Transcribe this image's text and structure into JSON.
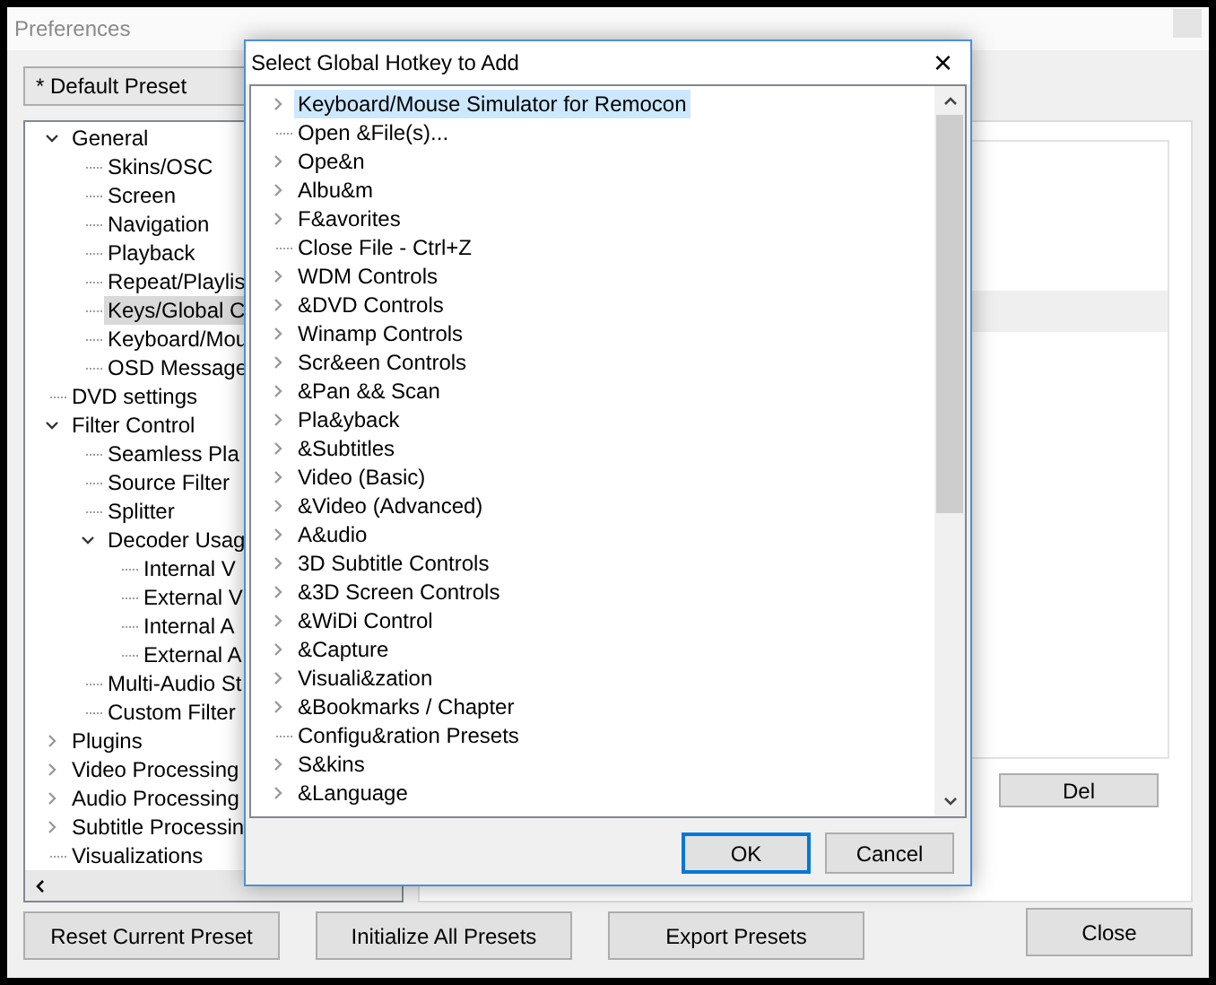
{
  "window": {
    "title": "Preferences"
  },
  "preset": {
    "value": "* Default Preset"
  },
  "tree": [
    {
      "label": "General",
      "kind": "branch",
      "expanded": true,
      "selected": false,
      "children": [
        {
          "label": "Skins/OSC",
          "kind": "leaf",
          "selected": false
        },
        {
          "label": "Screen",
          "kind": "leaf",
          "selected": false
        },
        {
          "label": "Navigation",
          "kind": "leaf",
          "selected": false
        },
        {
          "label": "Playback",
          "kind": "leaf",
          "selected": false
        },
        {
          "label": "Repeat/Playlis",
          "kind": "leaf",
          "selected": false
        },
        {
          "label": "Keys/Global C",
          "kind": "leaf",
          "selected": true
        },
        {
          "label": "Keyboard/Mou",
          "kind": "leaf",
          "selected": false
        },
        {
          "label": "OSD Message",
          "kind": "leaf",
          "selected": false
        }
      ]
    },
    {
      "label": "DVD settings",
      "kind": "leaf",
      "selected": false
    },
    {
      "label": "Filter Control",
      "kind": "branch",
      "expanded": true,
      "selected": false,
      "children": [
        {
          "label": "Seamless Pla",
          "kind": "leaf",
          "selected": false
        },
        {
          "label": "Source Filter",
          "kind": "leaf",
          "selected": false
        },
        {
          "label": "Splitter",
          "kind": "leaf",
          "selected": false
        },
        {
          "label": "Decoder Usag",
          "kind": "branch",
          "expanded": true,
          "selected": false,
          "children": [
            {
              "label": "Internal V",
              "kind": "leaf",
              "selected": false
            },
            {
              "label": "External V",
              "kind": "leaf",
              "selected": false
            },
            {
              "label": "Internal A",
              "kind": "leaf",
              "selected": false
            },
            {
              "label": "External A",
              "kind": "leaf",
              "selected": false
            }
          ]
        },
        {
          "label": "Multi-Audio St",
          "kind": "leaf",
          "selected": false
        },
        {
          "label": "Custom Filter",
          "kind": "leaf",
          "selected": false
        }
      ]
    },
    {
      "label": "Plugins",
      "kind": "branch",
      "expanded": false,
      "selected": false
    },
    {
      "label": "Video Processing",
      "kind": "branch",
      "expanded": false,
      "selected": false
    },
    {
      "label": "Audio Processing",
      "kind": "branch",
      "expanded": false,
      "selected": false
    },
    {
      "label": "Subtitle Processin",
      "kind": "branch",
      "expanded": false,
      "selected": false
    },
    {
      "label": "Visualizations",
      "kind": "leaf",
      "selected": false
    }
  ],
  "panel": {
    "buttons": [
      "Del"
    ]
  },
  "buttons": [
    "Reset Current Preset",
    "Initialize All Presets",
    "Export Presets"
  ],
  "close_button": "Close",
  "dialog": {
    "title": "Select Global Hotkey to Add",
    "close": "×",
    "items": [
      {
        "label": "Keyboard/Mouse Simulator for Remocon",
        "kind": "branch",
        "selected": true
      },
      {
        "label": "Open &File(s)...",
        "kind": "leaf",
        "selected": false
      },
      {
        "label": "Ope&n",
        "kind": "branch",
        "selected": false
      },
      {
        "label": "Albu&m",
        "kind": "branch",
        "selected": false
      },
      {
        "label": "F&avorites",
        "kind": "branch",
        "selected": false
      },
      {
        "label": "Close File - Ctrl+Z",
        "kind": "leaf",
        "selected": false
      },
      {
        "label": "WDM Controls",
        "kind": "branch",
        "selected": false
      },
      {
        "label": "&DVD Controls",
        "kind": "branch",
        "selected": false
      },
      {
        "label": "Winamp Controls",
        "kind": "branch",
        "selected": false
      },
      {
        "label": "Scr&een Controls",
        "kind": "branch",
        "selected": false
      },
      {
        "label": "&Pan && Scan",
        "kind": "branch",
        "selected": false
      },
      {
        "label": "Pla&yback",
        "kind": "branch",
        "selected": false
      },
      {
        "label": "&Subtitles",
        "kind": "branch",
        "selected": false
      },
      {
        "label": "Video (Basic)",
        "kind": "branch",
        "selected": false
      },
      {
        "label": "&Video (Advanced)",
        "kind": "branch",
        "selected": false
      },
      {
        "label": "A&udio",
        "kind": "branch",
        "selected": false
      },
      {
        "label": "3D Subtitle Controls",
        "kind": "branch",
        "selected": false
      },
      {
        "label": "&3D Screen Controls",
        "kind": "branch",
        "selected": false
      },
      {
        "label": "&WiDi Control",
        "kind": "branch",
        "selected": false
      },
      {
        "label": "&Capture",
        "kind": "branch",
        "selected": false
      },
      {
        "label": "Visuali&zation",
        "kind": "branch",
        "selected": false
      },
      {
        "label": "&Bookmarks / Chapter",
        "kind": "branch",
        "selected": false
      },
      {
        "label": "Configu&ration Presets",
        "kind": "leaf",
        "selected": false
      },
      {
        "label": "S&kins",
        "kind": "branch",
        "selected": false
      },
      {
        "label": "&Language",
        "kind": "branch",
        "selected": false
      }
    ],
    "buttons": [
      "OK",
      "Cancel"
    ]
  }
}
